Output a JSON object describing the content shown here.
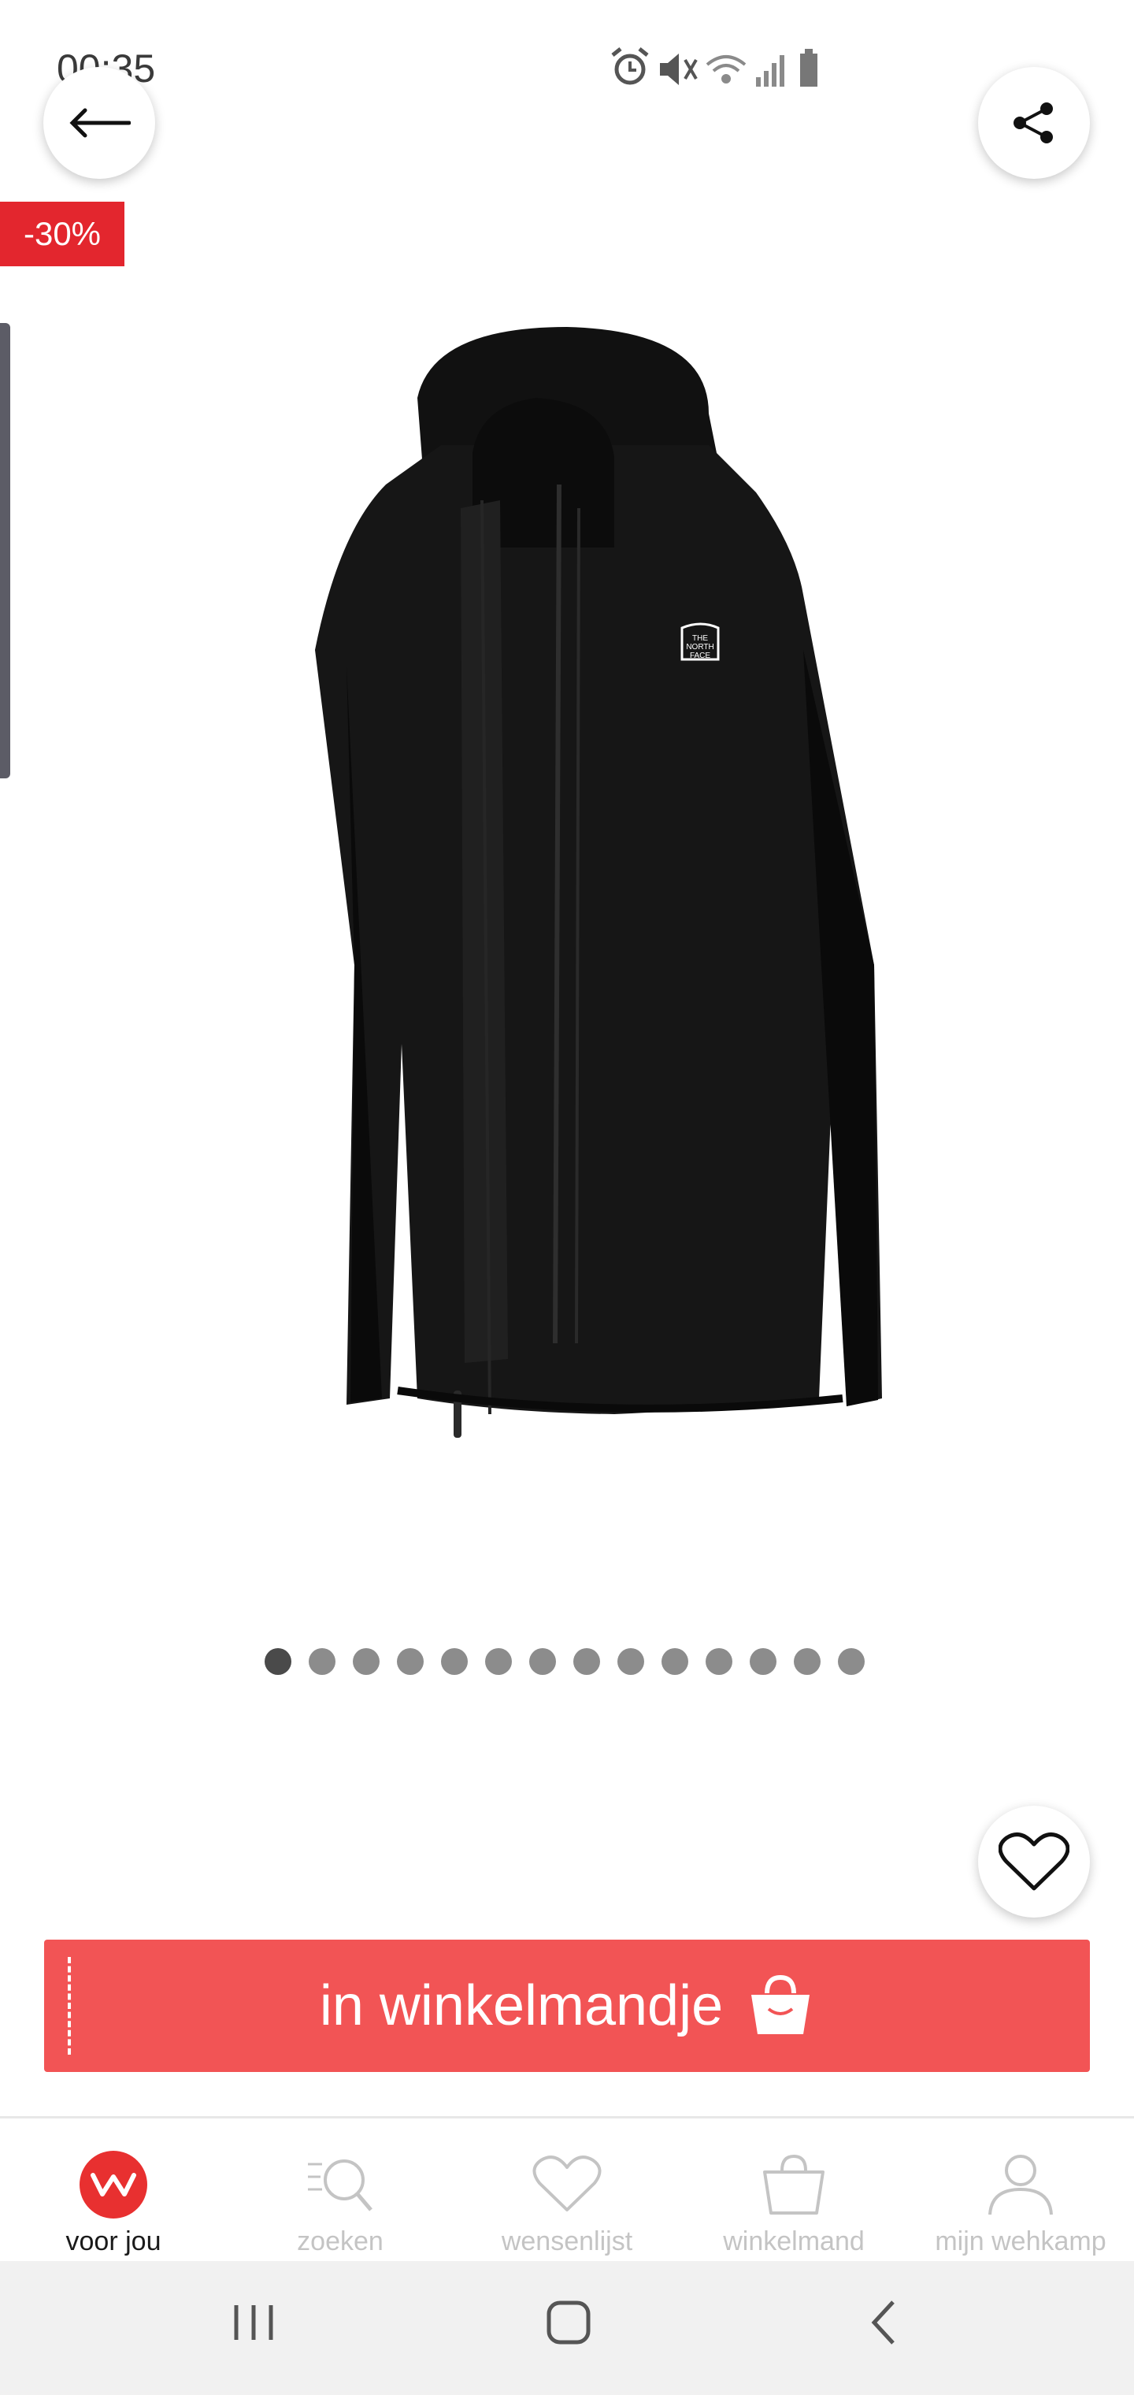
{
  "status_bar": {
    "time": "00:35",
    "icons": [
      "alarm-icon",
      "mute-icon",
      "wifi-icon",
      "signal-icon",
      "battery-icon"
    ]
  },
  "product": {
    "discount_badge": "-30%",
    "image_icon": "jacket-image",
    "logo_text": "THE NORTH FACE",
    "carousel": {
      "total": 14,
      "active_index": 0
    }
  },
  "actions": {
    "add_to_cart_label": "in winkelmandje"
  },
  "bottom_nav": {
    "items": [
      {
        "label": "voor jou",
        "icon": "w-logo-icon",
        "active": true
      },
      {
        "label": "zoeken",
        "icon": "search-icon",
        "active": false
      },
      {
        "label": "wensenlijst",
        "icon": "heart-icon",
        "active": false
      },
      {
        "label": "winkelmand",
        "icon": "bag-icon",
        "active": false
      },
      {
        "label": "mijn wehkamp",
        "icon": "user-icon",
        "active": false
      }
    ]
  },
  "colors": {
    "accent": "#f25455",
    "badge": "#e3262e",
    "brand_logo": "#e83030",
    "inactive_nav": "#c4c4c4"
  }
}
